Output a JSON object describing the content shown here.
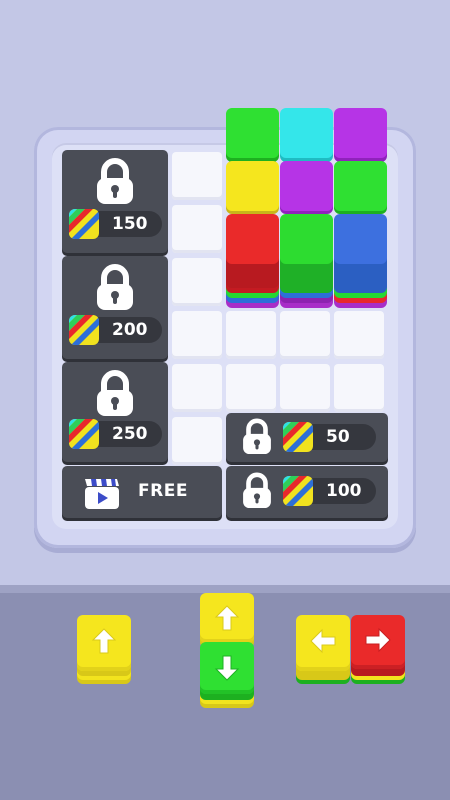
{
  "board": {
    "locks": [
      {
        "price": "150"
      },
      {
        "price": "200"
      },
      {
        "price": "250"
      },
      {
        "price": "50"
      },
      {
        "price": "100"
      }
    ],
    "free_label": "FREE"
  },
  "stacks": [
    {
      "name": "green-red-stack",
      "top_color": "#e8242c",
      "layers": [
        "#a82ec8",
        "#2d6fd8",
        "#25d832",
        "#f3dc1e"
      ]
    },
    {
      "name": "green-stack",
      "top_color": "#29d830",
      "layers": [
        "#a82ec8",
        "#2d6fd8",
        "#25d832",
        "#f3dc1e"
      ]
    },
    {
      "name": "blue-stack",
      "top_color": "#3d70df",
      "layers": [
        "#a82ec8",
        "#2d6fd8",
        "#25d832",
        "#f3dc1e"
      ]
    }
  ],
  "colors": {
    "yellow": "#f5e61e",
    "green": "#28dc2c",
    "red": "#ea2a2a",
    "cyan": "#2ee6ea",
    "purple": "#b632e4",
    "blue": "#3a72e0",
    "lock_panel": "#4a4d56",
    "tray_bg": "#8b8fb2"
  },
  "tray": {
    "pieces": [
      {
        "name": "up-piece",
        "arrows": [
          "up"
        ]
      },
      {
        "name": "up-down-piece",
        "arrows": [
          "up",
          "down"
        ]
      },
      {
        "name": "left-right-piece",
        "arrows": [
          "left",
          "right"
        ]
      }
    ]
  }
}
